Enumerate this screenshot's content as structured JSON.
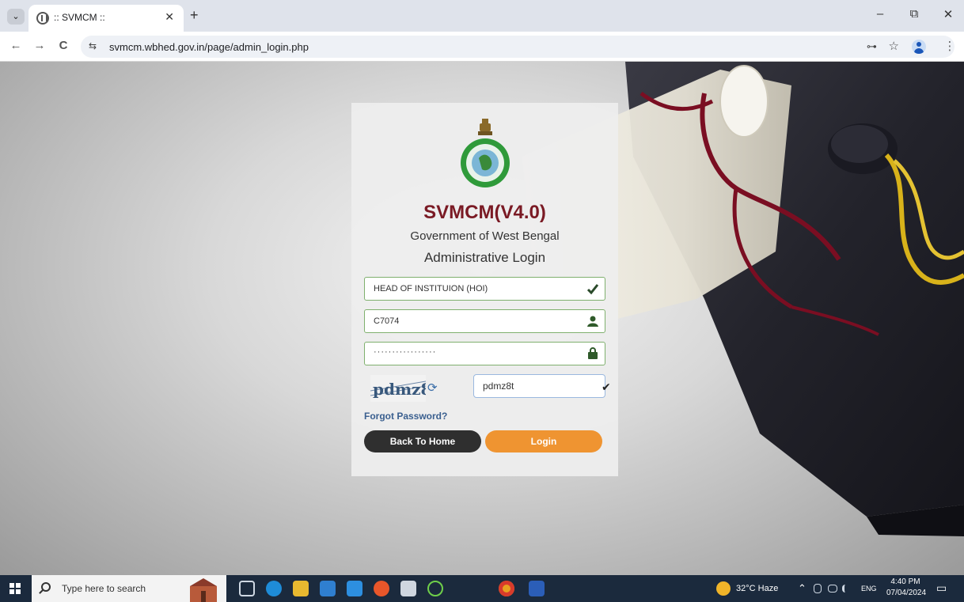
{
  "browser": {
    "tab_title": ":: SVMCM ::",
    "url": "svmcm.wbhed.gov.in/page/admin_login.php",
    "tab_menu_glyph": "⌄",
    "close_glyph": "✕",
    "new_tab_glyph": "+",
    "minimize_glyph": "–",
    "restore_glyph": "⧉",
    "window_close_glyph": "✕",
    "back_glyph": "←",
    "forward_glyph": "→",
    "reload_glyph": "C",
    "site_info_glyph": "⇆",
    "password_key_glyph": "⊶",
    "bookmark_glyph": "☆",
    "menu_glyph": "⋮"
  },
  "login": {
    "app_title": "SVMCM(V4.0)",
    "government": "Government of West Bengal",
    "heading": "Administrative Login",
    "role_value": "HEAD OF INSTITUION (HOI)",
    "username_value": "C7074",
    "password_mask": "·················",
    "captcha_image_text": "pdmz8t",
    "captcha_input_value": "pdmz8t",
    "refresh_glyph": "⟳",
    "check_glyph": "✔",
    "forgot_password": "Forgot Password?",
    "back_home_label": "Back To Home",
    "login_label": "Login",
    "accent_color": "#7a1a24",
    "login_button_color": "#ef9431",
    "back_button_color": "#2f2f2f"
  },
  "taskbar": {
    "search_placeholder": "Type here to search",
    "weather": "32°C  Haze",
    "language": "ENG",
    "time": "4:40 PM",
    "date": "07/04/2024",
    "tray_glyphs": "⌃",
    "notification_glyph": "▭"
  }
}
